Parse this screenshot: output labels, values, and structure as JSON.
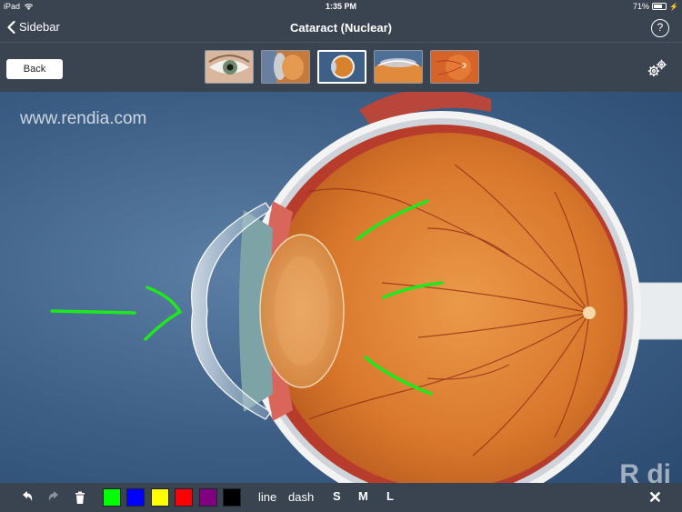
{
  "status_bar": {
    "device": "iPad",
    "time": "1:35 PM",
    "battery": "71%",
    "battery_level": 0.71
  },
  "nav": {
    "back_label": "Sidebar",
    "title": "Cataract (Nuclear)",
    "help_label": "?"
  },
  "toolbar": {
    "back_button": "Back",
    "thumbnails": [
      {
        "icon": "eye-exterior-thumbnail",
        "selected": false
      },
      {
        "icon": "eye-lens-closeup-thumbnail",
        "selected": false
      },
      {
        "icon": "eye-crosssection-thumbnail",
        "selected": true
      },
      {
        "icon": "eye-anterior-thumbnail",
        "selected": false
      },
      {
        "icon": "retina-fundus-thumbnail",
        "selected": false
      }
    ],
    "settings_icon": "gears-icon"
  },
  "main": {
    "watermark": "www.rendia.com",
    "watermark_partial": "R   di"
  },
  "drawing_toolbar": {
    "colors": [
      "#00ff00",
      "#0000ff",
      "#ffff00",
      "#ff0000",
      "#800080",
      "#000000"
    ],
    "line_label": "line",
    "dash_label": "dash",
    "sizes": [
      "S",
      "M",
      "L"
    ],
    "close_label": "✕"
  },
  "annotations": {
    "stroke_color": "#1ee81e"
  }
}
